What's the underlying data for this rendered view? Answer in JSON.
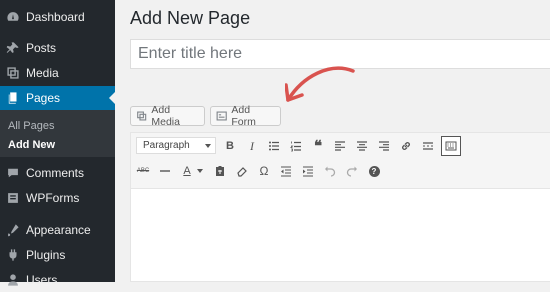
{
  "sidebar": {
    "items": [
      {
        "label": "Dashboard",
        "icon": "dashboard-icon"
      },
      {
        "label": "Posts",
        "icon": "pin-icon"
      },
      {
        "label": "Media",
        "icon": "media-icon"
      },
      {
        "label": "Pages",
        "icon": "pages-icon"
      },
      {
        "label": "Comments",
        "icon": "comments-icon"
      },
      {
        "label": "WPForms",
        "icon": "forms-icon"
      },
      {
        "label": "Appearance",
        "icon": "appearance-icon"
      },
      {
        "label": "Plugins",
        "icon": "plugins-icon"
      },
      {
        "label": "Users",
        "icon": "users-icon"
      }
    ],
    "submenu": [
      "All Pages",
      "Add New"
    ],
    "active": "Pages",
    "current_submenu": "Add New"
  },
  "main": {
    "title": "Add New Page",
    "title_placeholder": "Enter title here",
    "add_media_label": "Add Media",
    "add_form_label": "Add Form"
  },
  "toolbar": {
    "format_value": "Paragraph",
    "row1_icons": [
      "bold-icon",
      "italic-icon",
      "bullet-list-icon",
      "numbered-list-icon",
      "blockquote-icon",
      "align-left-icon",
      "align-center-icon",
      "align-right-icon",
      "link-icon",
      "more-tag-icon",
      "toolbar-toggle-icon"
    ],
    "row2_icons": [
      "strikethrough-icon",
      "horizontal-line-icon",
      "text-color-icon",
      "paste-text-icon",
      "clear-formatting-icon",
      "special-character-icon",
      "outdent-icon",
      "indent-icon",
      "undo-icon",
      "redo-icon",
      "help-icon"
    ],
    "bold_glyph": "B",
    "italic_glyph": "I",
    "quote_glyph": "❝",
    "text_color_glyph": "A",
    "omega_glyph": "Ω",
    "strike_glyph": "ABC",
    "help_glyph": "?"
  },
  "colors": {
    "sidebar_bg": "#23282d",
    "active_bg": "#0073aa",
    "annotation_arrow": "#d9534f"
  }
}
